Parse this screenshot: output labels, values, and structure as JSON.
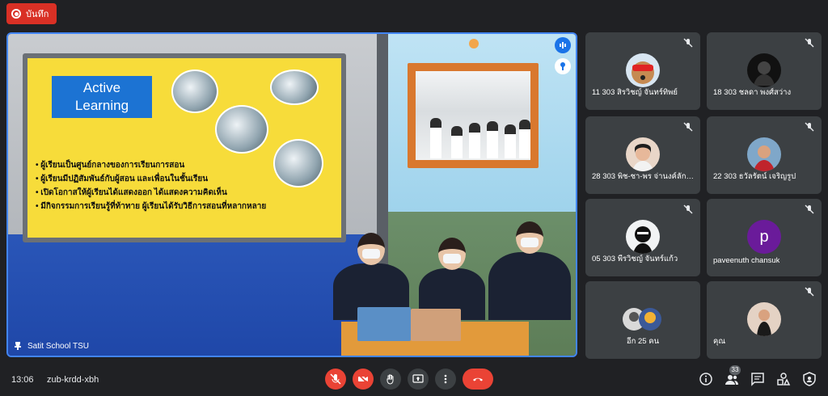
{
  "recording": {
    "label": "บันทึก",
    "color": "#d93025"
  },
  "stage": {
    "presenter_name": "Satit School TSU",
    "slide": {
      "title_line1": "Active",
      "title_line2": "Learning",
      "bullets": [
        "ผู้เรียนเป็นศูนย์กลางของการเรียนการสอน",
        "ผู้เรียนมีปฏิสัมพันธ์กับผู้สอน และเพื่อนในชั้นเรียน",
        "เปิดโอกาสให้ผู้เรียนได้แสดงออก ได้แสดงความคิดเห็น",
        "มีกิจกรรมการเรียนรู้ที่ท้าทาย ผู้เรียนได้รับวิธีการสอนที่หลากหลาย"
      ]
    }
  },
  "participants": [
    {
      "name": "11 303 สิรวิชญ์ จันทร์ทิพย์",
      "avatar": "dog-sunglasses"
    },
    {
      "name": "18 303 ชลดา พงศ์สว่าง",
      "avatar": "dark-figure"
    },
    {
      "name": "28 303 พิช-ชา-พร จ่านงค์ลักษ...",
      "avatar": "girl-photo"
    },
    {
      "name": "22 303 ธวัลรัตน์ เจริญรูป",
      "avatar": "girl-red"
    },
    {
      "name": "05 303 พีรวิชญ์ จันทร์แก้ว",
      "avatar": "masked-figure"
    },
    {
      "name": "paveenuth chansuk",
      "avatar_letter": "p"
    },
    {
      "name": "อีก 25 คน",
      "avatar": "two-faces"
    },
    {
      "name": "คุณ",
      "avatar": "self-photo"
    }
  ],
  "bottom_bar": {
    "time": "13:06",
    "meeting_code": "zub-krdd-xbh",
    "participant_count": "33"
  },
  "colors": {
    "accent": "#1a73e8",
    "danger": "#ea4335",
    "tile": "#3c4043",
    "background": "#202124"
  }
}
